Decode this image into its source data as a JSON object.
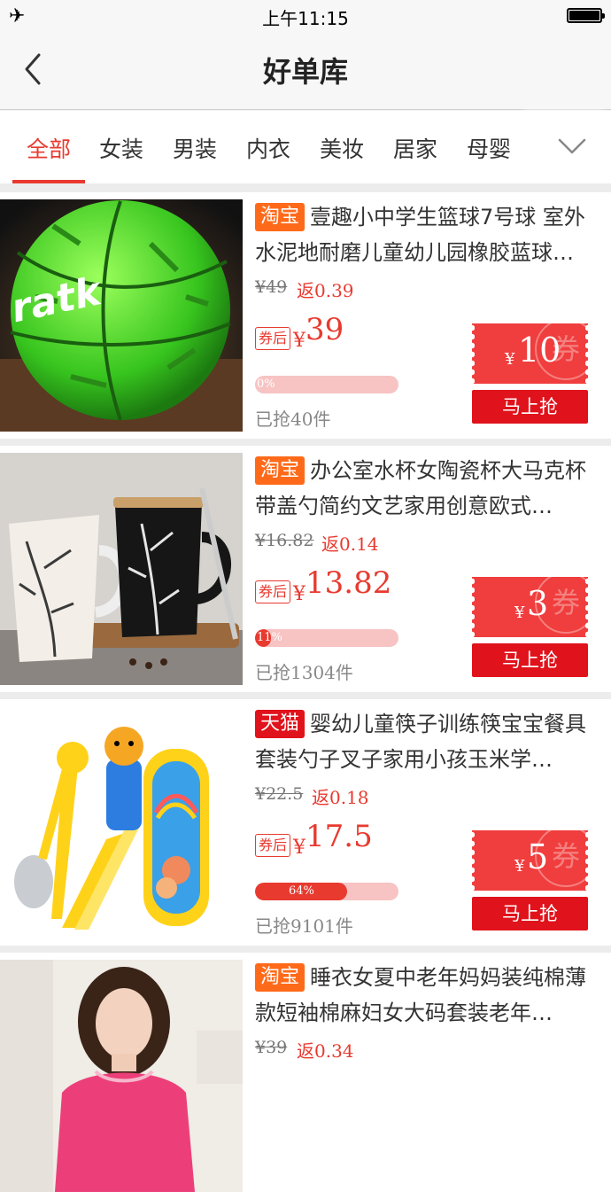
{
  "status_bar": {
    "time": "上午11:15",
    "icons": [
      "airplane-icon",
      "battery-icon"
    ]
  },
  "nav": {
    "title": "好单库",
    "back_icon": "chevron-left-icon"
  },
  "tabs": {
    "items": [
      "全部",
      "女装",
      "男装",
      "内衣",
      "美妆",
      "居家",
      "母婴"
    ],
    "active_index": 0,
    "more_icon": "chevron-down-icon"
  },
  "colors": {
    "accent": "#e83a2f",
    "taobao": "#ff6a1a",
    "tmall": "#e0121b"
  },
  "products": [
    {
      "platform": "淘宝",
      "platform_type": "taobao",
      "title": "壹趣小中学生篮球7号球 室外水泥地耐磨儿童幼儿园橡胶蓝球…",
      "original_price": "¥49",
      "rebate": "返0.39",
      "after_label": "券后",
      "price_symbol": "¥",
      "price": "39",
      "progress_pct": 0,
      "progress_label": "0%",
      "sold": "已抢40件",
      "coupon_symbol": "¥",
      "coupon_value": "10",
      "coupon_stamp": "券",
      "grab_label": "马上抢",
      "image": "green-basketball"
    },
    {
      "platform": "淘宝",
      "platform_type": "taobao",
      "title": "办公室水杯女陶瓷杯大马克杯带盖勺简约文艺家用创意欧式…",
      "original_price": "¥16.82",
      "rebate": "返0.14",
      "after_label": "券后",
      "price_symbol": "¥",
      "price": "13.82",
      "progress_pct": 11,
      "progress_label": "11%",
      "sold": "已抢1304件",
      "coupon_symbol": "¥",
      "coupon_value": "3",
      "coupon_stamp": "券",
      "grab_label": "马上抢",
      "image": "ceramic-mugs"
    },
    {
      "platform": "天猫",
      "platform_type": "tmall",
      "title": "婴幼儿童筷子训练筷宝宝餐具套装勺子叉子家用小孩玉米学…",
      "original_price": "¥22.5",
      "rebate": "返0.18",
      "after_label": "券后",
      "price_symbol": "¥",
      "price": "17.5",
      "progress_pct": 64,
      "progress_label": "64%",
      "sold": "已抢9101件",
      "coupon_symbol": "¥",
      "coupon_value": "5",
      "coupon_stamp": "券",
      "grab_label": "马上抢",
      "image": "kids-chopsticks-set"
    },
    {
      "platform": "淘宝",
      "platform_type": "taobao",
      "title": "睡衣女夏中老年妈妈装纯棉薄款短袖棉麻妇女大码套装老年…",
      "original_price": "¥39",
      "rebate": "返0.34",
      "image": "pajama-model"
    }
  ]
}
